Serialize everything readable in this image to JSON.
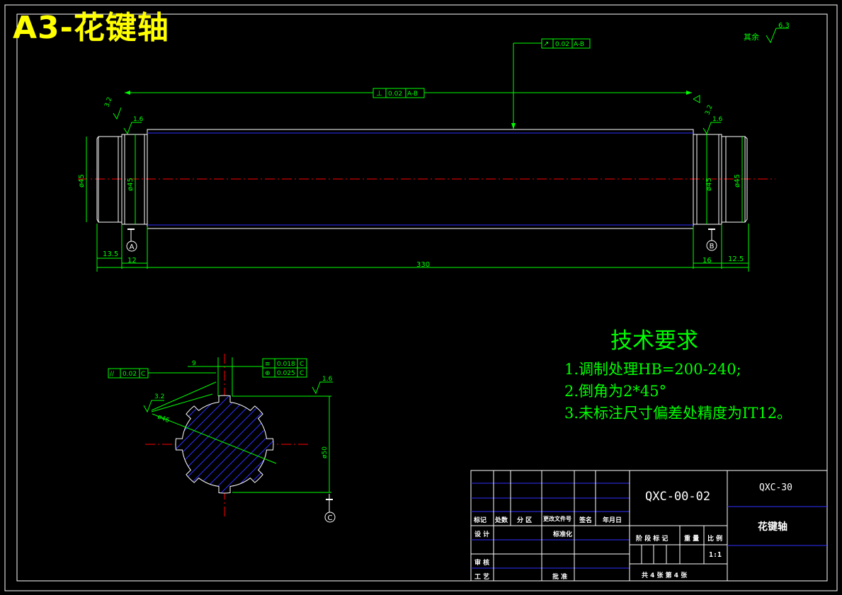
{
  "title_banner": "A3-花键轴",
  "surface_note": {
    "label": "其余",
    "roughness": "6.3"
  },
  "views": {
    "front": {
      "total_length": "330",
      "left_step": "13.5",
      "left_journal": "12",
      "right_journal": "16",
      "right_step": "12.5",
      "dia_left_outer": "ø45",
      "dia_left_journal": "ø45",
      "dia_right_journal": "ø45",
      "dia_right_outer": "ø45",
      "tol_top": {
        "symbol": "⊥",
        "value": "0.02",
        "datum": "A-B"
      },
      "tol_runout": {
        "symbol": "↗",
        "value": "0.02",
        "datum": "A-B"
      },
      "rough_left_a": "3.2",
      "rough_left_b": "1.6",
      "rough_right_a": "3.2",
      "rough_right_b": "1.6",
      "datum_a": "A",
      "datum_b": "B"
    },
    "section": {
      "key_width": "9",
      "dia_inner": "ø46",
      "dia_outer": "ø50",
      "tol_parallel": {
        "symbol": "//",
        "value": "0.02",
        "datum": "C"
      },
      "tol_symmetry": {
        "symbol": "≡",
        "value": "0.018",
        "datum": "C"
      },
      "tol_position": {
        "symbol": "⊕",
        "value": "0.025",
        "datum": "C"
      },
      "rough_a": "3.2",
      "rough_b": "1.6",
      "datum_c": "C"
    }
  },
  "technical_requirements": {
    "title": "技术要求",
    "items": [
      "1.调制处理HB=200-240;",
      "2.倒角为2*45°",
      "3.未标注尺寸偏差处精度为IT12。"
    ]
  },
  "title_block": {
    "drawing_no": "QXC-00-02",
    "project_code": "QXC-30",
    "part_name": "花键轴",
    "scale": "1:1",
    "headers": [
      "标记",
      "处数",
      "分 区",
      "更改文件号",
      "签名",
      "年月日"
    ],
    "roles": {
      "design": "设 计",
      "standard": "标准化",
      "review": "审 核",
      "process": "工 艺",
      "approve": "批 准"
    },
    "stage_labels": "阶 段 标 记",
    "weight_label": "重 量",
    "scale_label": "比 例",
    "sheet_info": "共 4 张   第 4 张"
  }
}
